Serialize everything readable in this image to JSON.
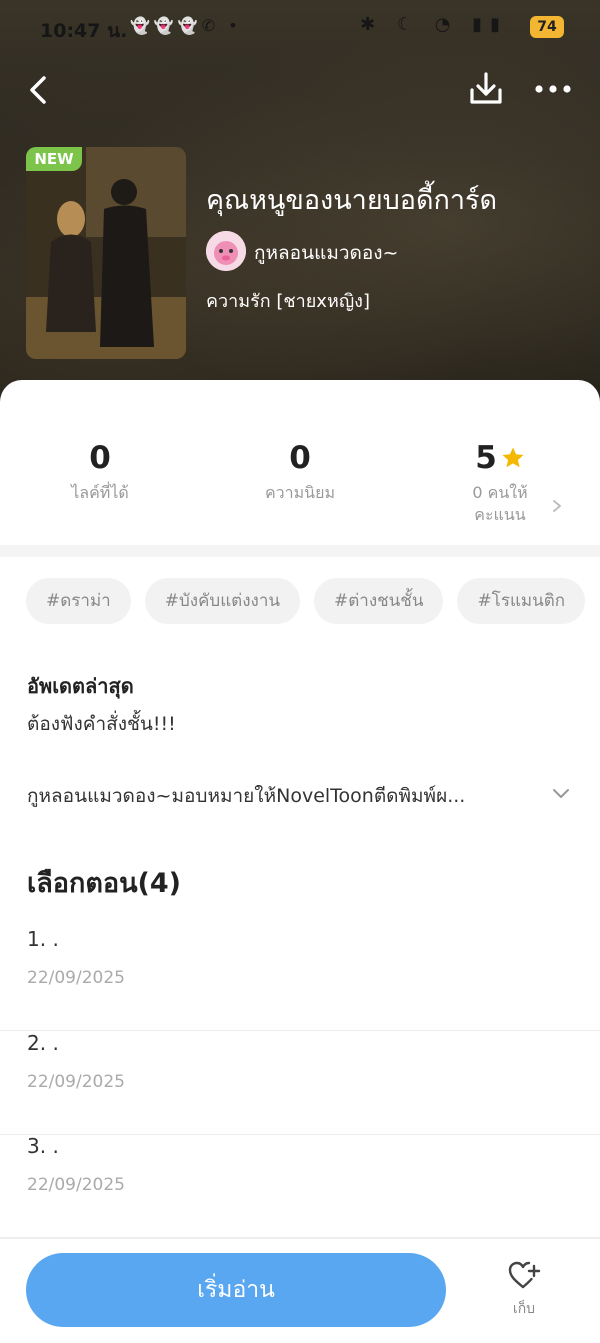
{
  "status_bar": {
    "time": "10:47 น.",
    "battery": "74"
  },
  "book": {
    "badge": "NEW",
    "title": "คุณหนูของนายบอดี้การ์ด",
    "author": "กูหลอนแมวดอง~",
    "genre": "ความรัก [ชายxหญิง]"
  },
  "stats": {
    "likes_value": "0",
    "likes_label": "ไลค์ที่ได้",
    "popularity_value": "0",
    "popularity_label": "ความนิยม",
    "rating_value": "5",
    "rating_label_line1": "0 คนให้",
    "rating_label_line2": "คะแนน"
  },
  "tags": [
    "#ดราม่า",
    "#บังคับแต่งงาน",
    "#ต่างชนชั้น",
    "#โรแมนติก"
  ],
  "update": {
    "label": "อัพเดตล่าสุด",
    "text": "ต้องฟังคำสั่งชั้น!!!"
  },
  "description": "กูหลอนแมวดอง~มอบหมายให้NovelToonตีดพิมพ์ผ...",
  "chapters": {
    "title": "เลือกตอน(4)",
    "items": [
      {
        "name": "1. .",
        "date": "22/09/2025"
      },
      {
        "name": "2. .",
        "date": "22/09/2025"
      },
      {
        "name": "3. .",
        "date": "22/09/2025"
      }
    ]
  },
  "actions": {
    "start_label": "เริ่มอ่าน",
    "save_label": "เก็บ"
  },
  "colors": {
    "accent": "#5aa7f1",
    "badge": "#7cc44a",
    "star": "#f5b800"
  }
}
